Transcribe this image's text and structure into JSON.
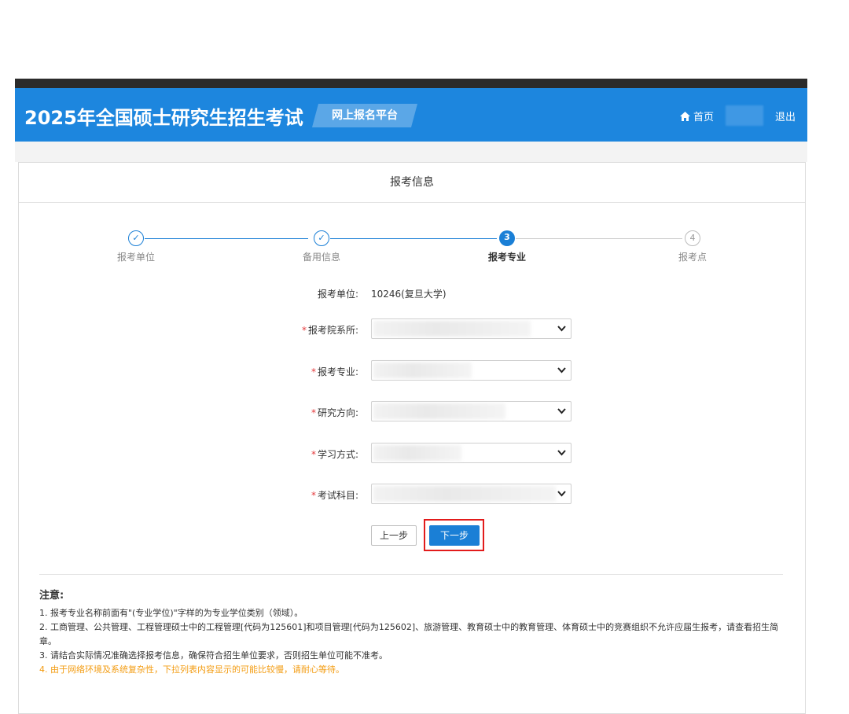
{
  "header": {
    "title": "2025年全国硕士研究生招生考试",
    "platform": "网上报名平台",
    "home": "首页",
    "logout": "退出"
  },
  "panel": {
    "title": "报考信息"
  },
  "steps": [
    {
      "label": "报考单位",
      "marker": "✓",
      "state": "done"
    },
    {
      "label": "备用信息",
      "marker": "✓",
      "state": "done"
    },
    {
      "label": "报考专业",
      "marker": "3",
      "state": "active"
    },
    {
      "label": "报考点",
      "marker": "4",
      "state": "pending"
    }
  ],
  "form": {
    "unit_label": "报考单位:",
    "unit_value": "10246(复旦大学)",
    "required_mark": "*",
    "department_label": "报考院系所:",
    "major_label": "报考专业:",
    "direction_label": "研究方向:",
    "study_mode_label": "学习方式:",
    "subjects_label": "考试科目:"
  },
  "buttons": {
    "prev": "上一步",
    "next": "下一步"
  },
  "notes": {
    "title": "注意:",
    "items": [
      "1. 报考专业名称前面有\"(专业学位)\"字样的为专业学位类别（领域）。",
      "2. 工商管理、公共管理、工程管理硕士中的工程管理[代码为125601]和项目管理[代码为125602]、旅游管理、教育硕士中的教育管理、体育硕士中的竞赛组织不允许应届生报考，请查看招生简章。",
      "3. 请结合实际情况准确选择报考信息，确保符合招生单位要求，否则招生单位可能不准考。",
      "4. 由于网络环境及系统复杂性，下拉列表内容显示的可能比较慢，请耐心等待。"
    ]
  },
  "colors": {
    "header_bg": "#1d86de",
    "primary": "#1a7fd6",
    "required": "#e4393c",
    "warning": "#f39c12",
    "highlight": "#e21b1b"
  }
}
